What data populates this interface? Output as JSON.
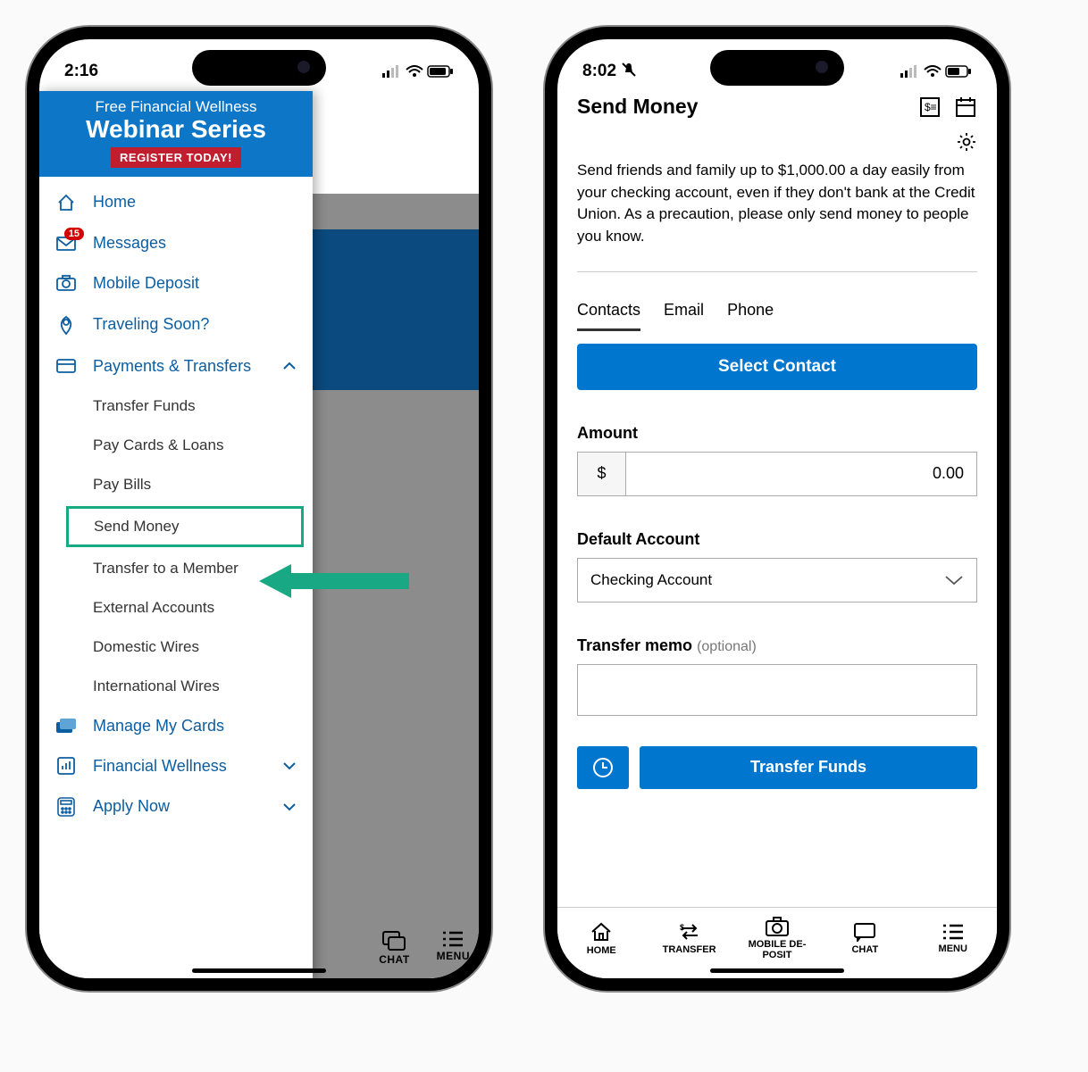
{
  "phone1": {
    "time": "2:16",
    "promo": {
      "line1": "Free Financial Wellness",
      "line2": "Webinar Series",
      "cta": "REGISTER TODAY!"
    },
    "badge": "15",
    "menu": {
      "home": "Home",
      "messages": "Messages",
      "deposit": "Mobile Deposit",
      "travel": "Traveling Soon?",
      "payments": "Payments & Transfers",
      "cards": "Manage My Cards",
      "wellness": "Financial Wellness",
      "apply": "Apply Now"
    },
    "sub": {
      "transfer_funds": "Transfer Funds",
      "pay_cards": "Pay Cards & Loans",
      "pay_bills": "Pay Bills",
      "send_money": "Send Money",
      "to_member": "Transfer to a Member",
      "external": "External Accounts",
      "dom_wires": "Domestic Wires",
      "intl_wires": "International Wires"
    },
    "bottom": {
      "chat": "CHAT",
      "menu": "MENU"
    }
  },
  "phone2": {
    "time": "8:02",
    "title": "Send Money",
    "intro": "Send friends and family up to $1,000.00 a day easily from your checking account, even if they don't bank at the Credit Union. As a precaution, please only send money to people you know.",
    "tabs": {
      "contacts": "Contacts",
      "email": "Email",
      "phone": "Phone"
    },
    "select_contact": "Select Contact",
    "labels": {
      "amount": "Amount",
      "account": "Default Account",
      "memo": "Transfer memo",
      "optional": "(optional)"
    },
    "currency": "$",
    "amount_value": "0.00",
    "account_value": "Checking Account",
    "transfer_btn": "Transfer Funds",
    "nav": {
      "home": "HOME",
      "transfer": "TRANSFER",
      "deposit": "MOBILE DE-\nPOSIT",
      "chat": "CHAT",
      "menu": "MENU"
    }
  }
}
